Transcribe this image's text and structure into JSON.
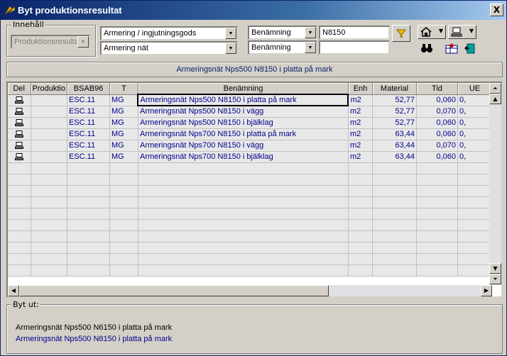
{
  "window": {
    "title": "Byt produktionsresultat",
    "close_label": "X"
  },
  "filter": {
    "innehall_legend": "Innehåll",
    "innehall_value": "Produktionsresultat",
    "category1": "Armering / ingjutningsgods",
    "category2": "Armering nät",
    "search_field1": "Benämning",
    "search_field2": "Benämning",
    "search_value1": "N8150",
    "search_value2": ""
  },
  "selected_header": "Armeringsnät Nps500 N8150 i platta på mark",
  "table": {
    "columns": [
      "Del",
      "Produktio",
      "BSAB96",
      "T",
      "Benämning",
      "Enh",
      "Material",
      "Tid",
      "UE"
    ],
    "rows": [
      {
        "bsab": "ESC.11",
        "t": "MG",
        "benamning": "Armeringsnät Nps500 N8150 i platta på mark",
        "enh": "m2",
        "material": "52,77",
        "tid": "0,060",
        "ue": "0,"
      },
      {
        "bsab": "ESC.11",
        "t": "MG",
        "benamning": "Armeringsnät Nps500 N8150 i vägg",
        "enh": "m2",
        "material": "52,77",
        "tid": "0,070",
        "ue": "0,"
      },
      {
        "bsab": "ESC.11",
        "t": "MG",
        "benamning": "Armeringsnät Nps500 N8150 i bjälklag",
        "enh": "m2",
        "material": "52,77",
        "tid": "0,060",
        "ue": "0,"
      },
      {
        "bsab": "ESC.11",
        "t": "MG",
        "benamning": "Armeringsnät Nps700 N8150 i platta på mark",
        "enh": "m2",
        "material": "63,44",
        "tid": "0,060",
        "ue": "0,"
      },
      {
        "bsab": "ESC.11",
        "t": "MG",
        "benamning": "Armeringsnät Nps700 N8150 i vägg",
        "enh": "m2",
        "material": "63,44",
        "tid": "0,070",
        "ue": "0,"
      },
      {
        "bsab": "ESC.11",
        "t": "MG",
        "benamning": "Armeringsnät Nps700 N8150 i bjälklag",
        "enh": "m2",
        "material": "63,44",
        "tid": "0,060",
        "ue": "0,"
      }
    ]
  },
  "bytut": {
    "legend": "Byt ut:",
    "from": "Armeringsnät Nps500 N6150 i platta på mark",
    "to": "Armeringsnät Nps500 N8150 i platta på mark"
  }
}
